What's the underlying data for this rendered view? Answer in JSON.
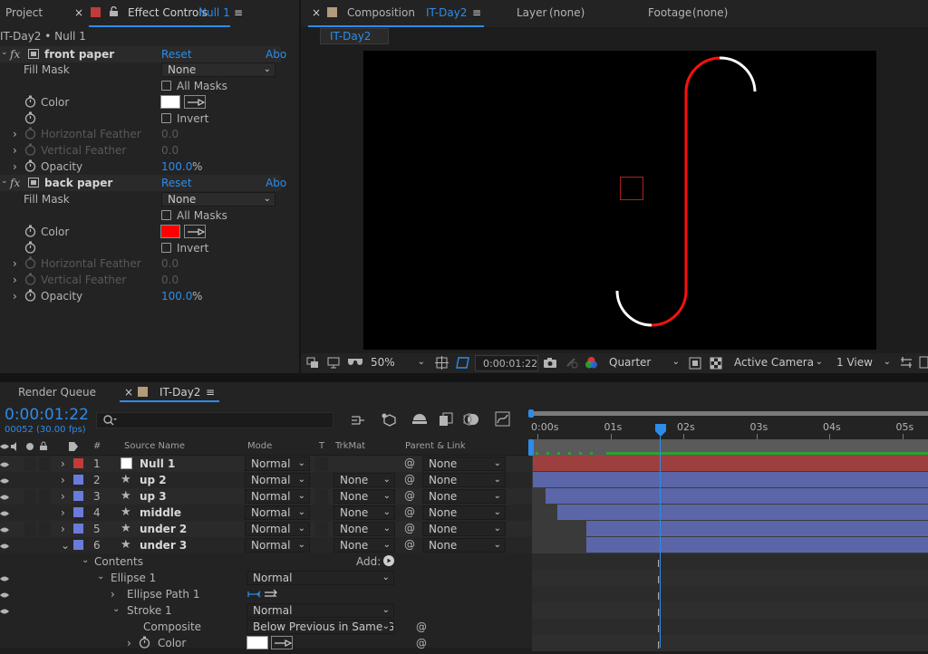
{
  "panels": {
    "project": "Project",
    "effect_controls": "Effect Controls",
    "effect_target": "Null 1",
    "composition_label": "Composition",
    "composition_name": "IT-Day2",
    "layer": "Layer",
    "layer_value": "(none)",
    "footage": "Footage",
    "footage_value": "(none)",
    "comp_tab": "IT-Day2",
    "render_queue": "Render Queue",
    "timeline_tab": "IT-Day2"
  },
  "effect_controls": {
    "breadcrumb": "IT-Day2 • Null 1",
    "groups": [
      {
        "name": "front paper",
        "reset": "Reset",
        "about": "Abo",
        "fill_mask": "Fill Mask",
        "fill_mask_value": "None",
        "all_masks": "All Masks",
        "color": "Color",
        "color_value": "#ffffff",
        "invert": "Invert",
        "h_feather": "Horizontal Feather",
        "h_feather_value": "0.0",
        "v_feather": "Vertical Feather",
        "v_feather_value": "0.0",
        "opacity": "Opacity",
        "opacity_value": "100.0",
        "opacity_unit": "%"
      },
      {
        "name": "back paper",
        "reset": "Reset",
        "about": "Abo",
        "fill_mask": "Fill Mask",
        "fill_mask_value": "None",
        "all_masks": "All Masks",
        "color": "Color",
        "color_value": "#ff0000",
        "invert": "Invert",
        "h_feather": "Horizontal Feather",
        "h_feather_value": "0.0",
        "v_feather": "Vertical Feather",
        "v_feather_value": "0.0",
        "opacity": "Opacity",
        "opacity_value": "100.0",
        "opacity_unit": "%"
      }
    ]
  },
  "viewer_toolbar": {
    "zoom": "50%",
    "timecode": "0:00:01:22",
    "resolution": "Quarter",
    "camera": "Active Camera",
    "views": "1 View"
  },
  "timeline": {
    "current_time": "0:00:01:22",
    "frame_info": "00052 (30.00 fps)",
    "columns": {
      "num": "#",
      "source": "Source Name",
      "mode": "Mode",
      "t": "T",
      "trkmat": "TrkMat",
      "parent": "Parent & Link"
    },
    "ruler": [
      "0:00s",
      "01s",
      "02s",
      "03s",
      "04s",
      "05s"
    ],
    "layers": [
      {
        "num": "1",
        "name": "Null 1",
        "label_color": "#c23b3b",
        "mode": "Normal",
        "trkmat": "",
        "parent": "None",
        "icon": "null-swatch",
        "start": 0.0
      },
      {
        "num": "2",
        "name": "up 2",
        "label_color": "#6b7bdb",
        "mode": "Normal",
        "trkmat": "None",
        "parent": "None",
        "icon": "star",
        "start": 0.0
      },
      {
        "num": "3",
        "name": "up 3",
        "label_color": "#6b7bdb",
        "mode": "Normal",
        "trkmat": "None",
        "parent": "None",
        "icon": "star",
        "start": 0.17
      },
      {
        "num": "4",
        "name": "middle",
        "label_color": "#6b7bdb",
        "mode": "Normal",
        "trkmat": "None",
        "parent": "None",
        "icon": "star",
        "start": 0.33
      },
      {
        "num": "5",
        "name": "under 2",
        "label_color": "#6b7bdb",
        "mode": "Normal",
        "trkmat": "None",
        "parent": "None",
        "icon": "star",
        "start": 0.73
      },
      {
        "num": "6",
        "name": "under 3",
        "label_color": "#6b7bdb",
        "mode": "Normal",
        "trkmat": "None",
        "parent": "None",
        "icon": "star",
        "start": 0.73
      }
    ],
    "contents": "Contents",
    "add": "Add:",
    "ellipse": "Ellipse 1",
    "ellipse_mode": "Normal",
    "ellipse_path": "Ellipse Path 1",
    "stroke": "Stroke 1",
    "stroke_mode": "Normal",
    "composite": "Composite",
    "composite_value": "Below Previous in Same Gr",
    "color": "Color"
  }
}
